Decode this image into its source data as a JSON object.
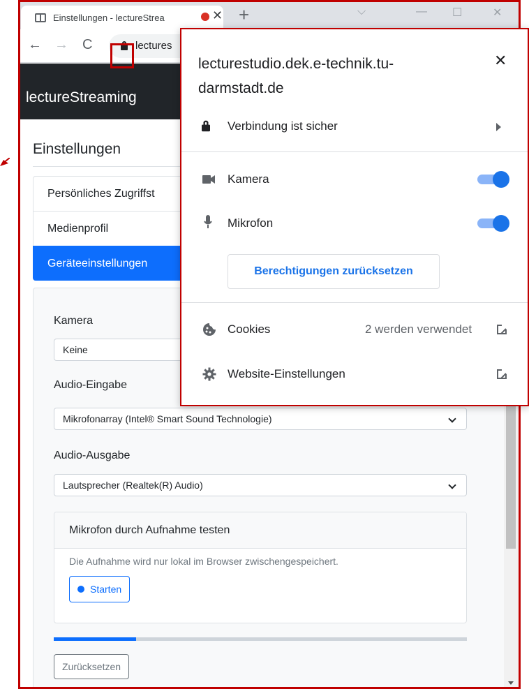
{
  "browser": {
    "tab_title": "Einstellungen - lectureStrea",
    "tab_close": "✕",
    "new_tab": "+",
    "window_controls": {
      "dropdown": "⌵",
      "minimize": "—",
      "maximize": "☐",
      "close": "✕"
    },
    "url_fragment": "lectures",
    "nav": {
      "back": "←",
      "forward": "→",
      "reload": "C"
    }
  },
  "page": {
    "brand": "lectureStreaming",
    "title": "Einstellungen",
    "settings_nav": [
      {
        "label": "Persönliches Zugriffst"
      },
      {
        "label": "Medienprofil"
      },
      {
        "label": "Geräteeinstellungen"
      }
    ],
    "devices": {
      "camera_label": "Kamera",
      "camera_value": "Keine",
      "audio_in_label": "Audio-Eingabe",
      "audio_in_value": "Mikrofonarray (Intel® Smart Sound Technologie)",
      "audio_out_label": "Audio-Ausgabe",
      "audio_out_value": "Lautsprecher (Realtek(R) Audio)",
      "mic_test_title": "Mikrofon durch Aufnahme testen",
      "mic_test_desc": "Die Aufnahme wird nur lokal im Browser zwischengespeichert.",
      "start_label": "Starten",
      "progress": 0.2,
      "reset_label": "Zurücksetzen"
    }
  },
  "popup": {
    "domain": "lecturestudio.dek.e-technik.tu-darmstadt.de",
    "close": "✕",
    "connection": "Verbindung ist sicher",
    "camera": {
      "label": "Kamera",
      "enabled": true
    },
    "microphone": {
      "label": "Mikrofon",
      "enabled": true
    },
    "reset_permissions": "Berechtigungen zurücksetzen",
    "cookies_label": "Cookies",
    "cookies_count": "2 werden verwendet",
    "site_settings": "Website-Einstellungen"
  },
  "colors": {
    "accent": "#0d6efd",
    "toggle_on": "#1a73e8",
    "annotation": "#c00000",
    "navbar": "#212529"
  }
}
